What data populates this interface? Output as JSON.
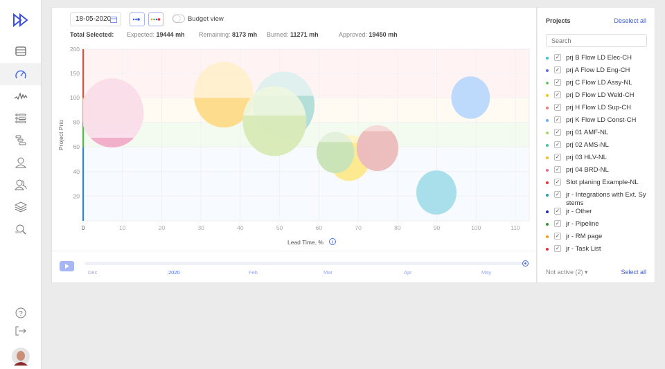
{
  "sidebar": {
    "items": [
      {
        "icon": "logo-fast-forward-icon"
      },
      {
        "icon": "table-icon"
      },
      {
        "icon": "dashboard-gauge-icon",
        "active": true
      },
      {
        "icon": "activity-chart-icon"
      },
      {
        "icon": "list-icon"
      },
      {
        "icon": "gantt-icon"
      },
      {
        "icon": "user-icon"
      },
      {
        "icon": "users-icon"
      },
      {
        "icon": "layers-icon"
      },
      {
        "icon": "search-report-icon"
      },
      {
        "icon": "help-icon"
      },
      {
        "icon": "logout-icon"
      },
      {
        "icon": "avatar"
      }
    ]
  },
  "toolbar": {
    "date": "18-05-2020",
    "budget_view": "Budget view",
    "budget_view_on": false
  },
  "stats": {
    "total": "Total Selected:",
    "expected_label": "Expected:",
    "expected": "19444 mh",
    "remaining_label": "Remaining:",
    "remaining": "8173 mh",
    "burned_label": "Burned:",
    "burned": "11271 mh",
    "approved_label": "Approved:",
    "approved": "19450 mh"
  },
  "chart_data": {
    "type": "bubble",
    "xlabel": "Lead Time, %",
    "ylabel": "Project Prio",
    "xlim": [
      0,
      112
    ],
    "ylim": [
      0,
      200
    ],
    "xticks": [
      0,
      10,
      20,
      30,
      40,
      50,
      60,
      70,
      80,
      90,
      100,
      110
    ],
    "yticks": [
      20,
      40,
      60,
      80,
      100,
      150,
      200
    ],
    "bands": [
      {
        "from": 100,
        "to": 200,
        "color": "#fff4f3",
        "axis": "#f44336"
      },
      {
        "from": 80,
        "to": 100,
        "color": "#fffbf2",
        "axis": "#ffa726"
      },
      {
        "from": 60,
        "to": 80,
        "color": "#f3fbf0",
        "axis": "#43c33a"
      },
      {
        "from": 0,
        "to": 60,
        "color": "#f7fbff",
        "axis": "#1e88e5"
      }
    ],
    "points": [
      {
        "x": 7.4,
        "y": 87.6,
        "size": 8.0,
        "fill_pct": 14,
        "light": "#f9dbe8",
        "dark": "#efaac6"
      },
      {
        "x": 35.8,
        "y": 106,
        "size": 7.6,
        "fill_pct": 45,
        "light": "#fff0cb",
        "dark": "#fdd985"
      },
      {
        "x": 51.1,
        "y": 93.8,
        "size": 7.8,
        "fill_pct": 64,
        "light": "#dcefee",
        "dark": "#afdbd5"
      },
      {
        "x": 48.7,
        "y": 81,
        "size": 8.1,
        "fill_pct": 58,
        "light": "#edf6df",
        "dark": "#d7e9b6"
      },
      {
        "x": 67.7,
        "y": 51,
        "size": 5.3,
        "fill_pct": 83,
        "light": "#fff4c0",
        "dark": "#fde88a"
      },
      {
        "x": 64.2,
        "y": 55.5,
        "size": 4.8,
        "fill_pct": 75,
        "light": "#e1f0d9",
        "dark": "#c6e1b4"
      },
      {
        "x": 74.9,
        "y": 59,
        "size": 5.3,
        "fill_pct": 87,
        "light": "#f5d6d6",
        "dark": "#ecbaba"
      },
      {
        "x": 98.6,
        "y": 100,
        "size": 4.9,
        "fill_pct": 100,
        "light": "#bcd8fb",
        "dark": "#bcd8fb"
      },
      {
        "x": 89.9,
        "y": 23,
        "size": 5.1,
        "fill_pct": 100,
        "light": "#a9dfea",
        "dark": "#a9dfea"
      }
    ]
  },
  "timeline": {
    "labels": [
      "Dec",
      "2020",
      "Feb",
      "Mar",
      "Apr",
      "May"
    ],
    "position_pct": 100
  },
  "projects": {
    "title": "Projects",
    "deselect_all": "Deselect all",
    "search_placeholder": "Search",
    "not_active": "Not active (2)",
    "select_all": "Select all",
    "items": [
      {
        "label": "prj B Flow LD Elec-CH",
        "color": "#3bbfe0"
      },
      {
        "label": "prj A Flow LD Eng-CH",
        "color": "#6a6fd6"
      },
      {
        "label": "prj C Flow LD Assy-NL",
        "color": "#6cc36a"
      },
      {
        "label": "prj D Flow LD Weld-CH",
        "color": "#f5c518"
      },
      {
        "label": "prj H Flow LD Sup-CH",
        "color": "#e87a7a"
      },
      {
        "label": "prj K Flow LD Const-CH",
        "color": "#6ab0f5"
      },
      {
        "label": "prj 01 AMF-NL",
        "color": "#a5d65a"
      },
      {
        "label": "prj 02 AMS-NL",
        "color": "#4fc1a2"
      },
      {
        "label": "prj 03 HLV-NL",
        "color": "#f5b82e"
      },
      {
        "label": "prj 04 BRD-NL",
        "color": "#e86a9a"
      },
      {
        "label": "Slot planing Example-NL",
        "color": "#f03030"
      },
      {
        "label": "jr - Integrations with Ext. Sy stems",
        "color": "#2b9bb0"
      },
      {
        "label": "jr - Other",
        "color": "#1f2bb0"
      },
      {
        "label": "jr - Pipeline",
        "color": "#2f9a2f"
      },
      {
        "label": "jr - RM page",
        "color": "#f5a020"
      },
      {
        "label": "jr - Task List",
        "color": "#f02a3a"
      }
    ]
  }
}
